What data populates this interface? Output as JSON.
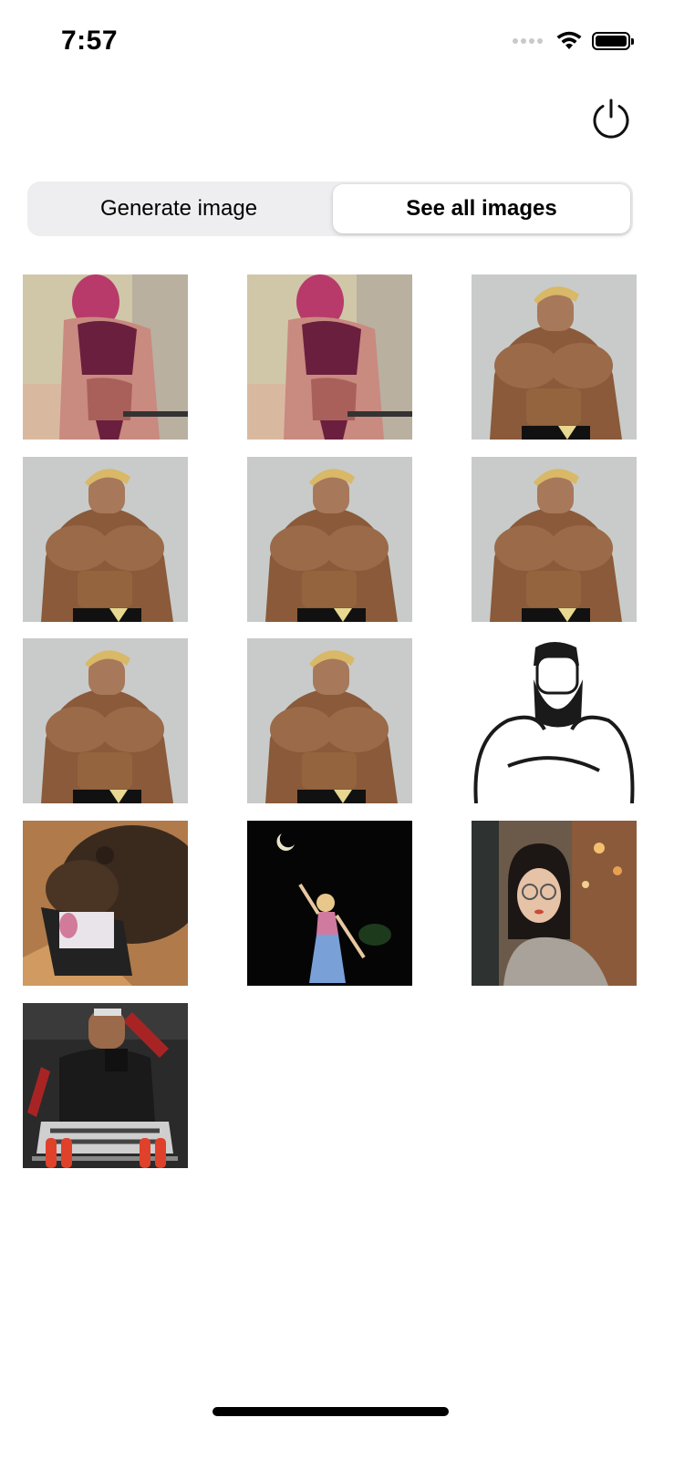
{
  "status_bar": {
    "time": "7:57"
  },
  "power_button": {
    "icon": "power-icon"
  },
  "segmented_control": {
    "options": [
      "Generate image",
      "See all images"
    ],
    "selected": "See all images"
  },
  "gallery": {
    "images": [
      {
        "kind": "muscular-anime-woman",
        "colors": {
          "bg": "#cfc7a8",
          "accent": "#6b1f3e"
        }
      },
      {
        "kind": "muscular-anime-woman",
        "colors": {
          "bg": "#cfc7a8",
          "accent": "#6b1f3e"
        }
      },
      {
        "kind": "muscular-blond-man",
        "colors": {
          "bg": "#c8cbc9",
          "accent": "#8a5a3a"
        }
      },
      {
        "kind": "muscular-blond-man",
        "colors": {
          "bg": "#c8cbc9",
          "accent": "#8a5a3a"
        }
      },
      {
        "kind": "muscular-blond-man",
        "colors": {
          "bg": "#c8cbc9",
          "accent": "#8a5a3a"
        }
      },
      {
        "kind": "muscular-blond-man",
        "colors": {
          "bg": "#c8cbc9",
          "accent": "#8a5a3a"
        }
      },
      {
        "kind": "muscular-blond-man",
        "colors": {
          "bg": "#c8cbc9",
          "accent": "#8a5a3a"
        }
      },
      {
        "kind": "muscular-blond-man",
        "colors": {
          "bg": "#c8cbc9",
          "accent": "#8a5a3a"
        }
      },
      {
        "kind": "bearded-man-sketch",
        "colors": {
          "bg": "#ffffff",
          "accent": "#1a1a1a"
        }
      },
      {
        "kind": "bear-with-laptop",
        "colors": {
          "bg": "#b07a4a",
          "accent": "#3a2a1e"
        }
      },
      {
        "kind": "doll-night-moon",
        "colors": {
          "bg": "#050505",
          "accent": "#d07aa0"
        }
      },
      {
        "kind": "woman-glasses-cafe",
        "colors": {
          "bg": "#6b5a4a",
          "accent": "#c84a3a"
        }
      },
      {
        "kind": "gym-man-dumbbells",
        "colors": {
          "bg": "#2a2a2a",
          "accent": "#e0412a"
        }
      }
    ]
  }
}
